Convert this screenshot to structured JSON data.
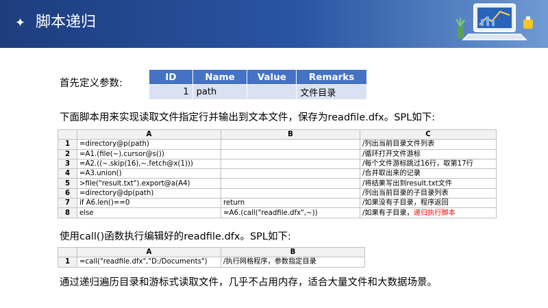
{
  "header": {
    "title": "脚本递归",
    "star": "✦"
  },
  "intro": "首先定义参数:",
  "params": {
    "headers": [
      "ID",
      "Name",
      "Value",
      "Remarks"
    ],
    "rows": [
      [
        "1",
        "path",
        "",
        "文件目录"
      ]
    ]
  },
  "desc1": "下面脚本用来实现读取文件指定行并输出到文本文件，保存为readfile.dfx。SPL如下:",
  "script1": {
    "cols": [
      "A",
      "B",
      "C"
    ],
    "rows": [
      {
        "n": "1",
        "a": "=directory@p(path)",
        "b": "",
        "c": "/列出当前目录文件列表",
        "c2": ""
      },
      {
        "n": "2",
        "a": "=A1.(file(~).cursor@s())",
        "b": "",
        "c": "/循环打开文件游标",
        "c2": ""
      },
      {
        "n": "3",
        "a": "=A2.((~.skip(16),~.fetch@x(1)))",
        "b": "",
        "c": "/每个文件游标跳过16行，取第17行",
        "c2": ""
      },
      {
        "n": "4",
        "a": "=A3.union()",
        "b": "",
        "c": "/合并取出来的记录",
        "c2": ""
      },
      {
        "n": "5",
        "a": ">file(\"result.txt\").export@a(A4)",
        "b": "",
        "c": "/将结果写出到result.txt文件",
        "c2": ""
      },
      {
        "n": "6",
        "a": "=directory@dp(path)",
        "b": "",
        "c": "/列出当前目录的子目录列表",
        "c2": ""
      },
      {
        "n": "7",
        "a": "if A6.len()==0",
        "b": "return",
        "c": "/如果没有子目录，程序返回",
        "c2": ""
      },
      {
        "n": "8",
        "a": "else",
        "b": "=A6.(call(\"readfile.dfx\",~))",
        "c": "/如果有子目录，",
        "c2": "递归执行脚本"
      }
    ]
  },
  "desc2": "使用call()函数执行编辑好的readfile.dfx。SPL如下:",
  "script2": {
    "cols": [
      "A",
      "B"
    ],
    "rows": [
      {
        "n": "1",
        "a": "=call(\"readfile.dfx\",\"D:/Documents\")",
        "b": "/执行网格程序，参数指定目录"
      }
    ]
  },
  "conclusion": "通过递归遍历目录和游标式读取文件，几乎不占用内存，适合大量文件和大数据场景。",
  "colors": {
    "header_start": "#1d3d7e",
    "header_end": "#6f9ad3",
    "table_head": "#4472c4",
    "table_cell": "#d9e1f2",
    "highlight": "#ff0000"
  }
}
